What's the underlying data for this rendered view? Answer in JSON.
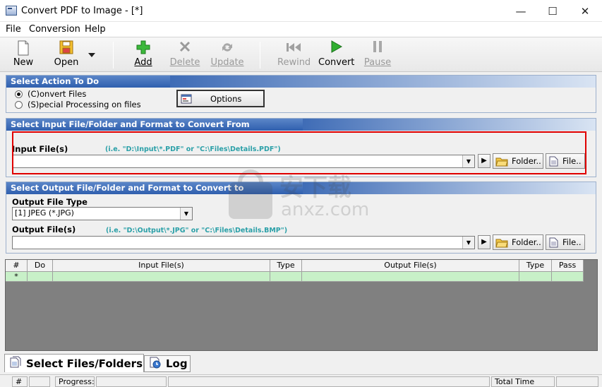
{
  "window": {
    "title": "Convert PDF to Image - [*]",
    "minimize": "—",
    "maximize": "☐",
    "close": "✕"
  },
  "menu": [
    "File",
    "Conversion",
    "Help"
  ],
  "toolbar": {
    "new": "New",
    "open": "Open",
    "add": "Add",
    "delete": "Delete",
    "update": "Update",
    "rewind": "Rewind",
    "convert": "Convert",
    "pause": "Pause"
  },
  "action_panel": {
    "header": "Select Action To Do",
    "option_convert": "(C)onvert Files",
    "option_special": "(S)pecial Processing on files",
    "options_button": "Options"
  },
  "input_panel": {
    "header": "Select Input File/Folder and Format to Convert From",
    "label": "Input File(s)",
    "hint": "(i.e. \"D:\\Input\\*.PDF\"  or \"C:\\Files\\Details.PDF\")",
    "value": "",
    "folder_button": "Folder..",
    "file_button": "File.."
  },
  "output_panel": {
    "header": "Select Output File/Folder and Format to Convert to",
    "type_label": "Output File Type",
    "type_value": "[1] JPEG (*.JPG)",
    "file_label": "Output File(s)",
    "hint": "(i.e. \"D:\\Output\\*.JPG\"  or \"C:\\Files\\Details.BMP\")",
    "value": "",
    "folder_button": "Folder..",
    "file_button": "File.."
  },
  "grid": {
    "columns": [
      "#",
      "Do",
      "Input File(s)",
      "Type",
      "Output File(s)",
      "Type",
      "Pass"
    ],
    "new_row_marker": "*"
  },
  "tabs": [
    "Select Files/Folders",
    "Log"
  ],
  "statusbar": {
    "count": "#",
    "progress": "Progress:",
    "total_time": "Total Time (Sec):"
  },
  "watermark": {
    "text": "安下载",
    "url": "anxz.com"
  },
  "colors": {
    "highlight": "#e00000",
    "panel_header": "#2f5fae",
    "hint": "#2ba0a8",
    "grid_row": "#c8f0c8"
  }
}
